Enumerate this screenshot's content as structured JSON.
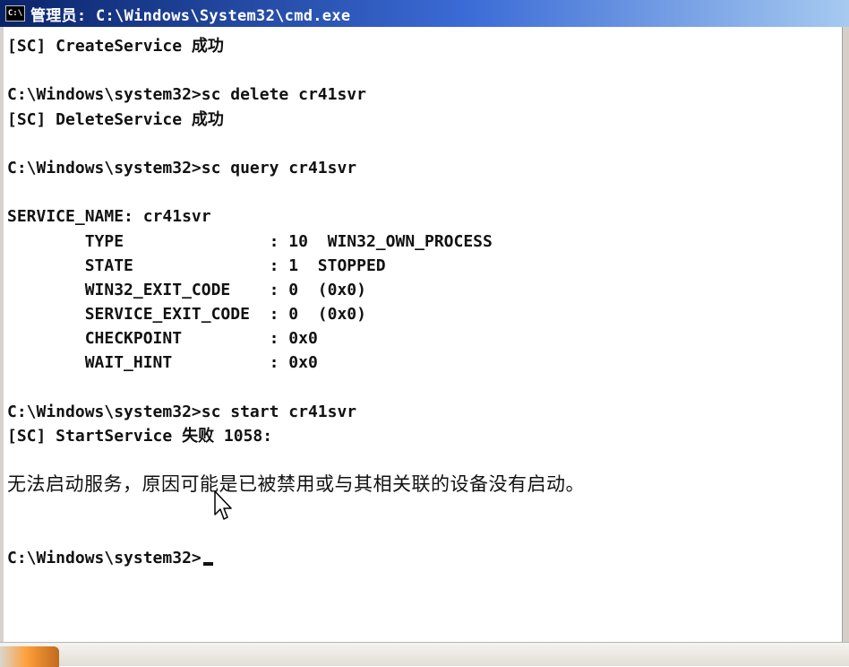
{
  "window": {
    "title": "管理员: C:\\Windows\\System32\\cmd.exe",
    "icon": "cmd-icon",
    "icon_text": "C:\\"
  },
  "console": {
    "lines": [
      "[SC] CreateService 成功",
      "",
      "C:\\Windows\\system32>sc delete cr41svr",
      "[SC] DeleteService 成功",
      "",
      "C:\\Windows\\system32>sc query cr41svr",
      "",
      "SERVICE_NAME: cr41svr",
      "        TYPE               : 10  WIN32_OWN_PROCESS",
      "        STATE              : 1  STOPPED",
      "        WIN32_EXIT_CODE    : 0  (0x0)",
      "        SERVICE_EXIT_CODE  : 0  (0x0)",
      "        CHECKPOINT         : 0x0",
      "        WAIT_HINT          : 0x0",
      "",
      "C:\\Windows\\system32>sc start cr41svr",
      "[SC] StartService 失败 1058:",
      "",
      "无法启动服务，原因可能是已被禁用或与其相关联的设备没有启动。",
      "",
      "",
      "C:\\Windows\\system32>"
    ]
  },
  "colors": {
    "title_start": "#0a246a",
    "title_end": "#a6caf0",
    "console_bg": "#ffffff",
    "console_text": "#111111",
    "start_button": "#ff9f3a"
  }
}
